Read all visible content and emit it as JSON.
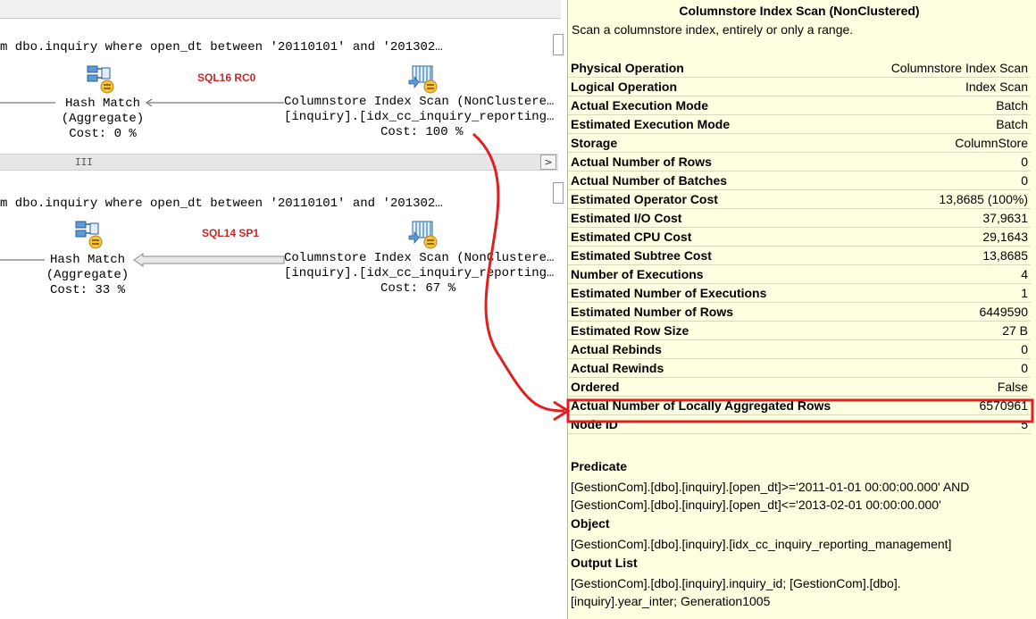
{
  "plan1": {
    "sql": "m dbo.inquiry where open_dt between '20110101' and '201302…",
    "tag": "SQL16 RC0",
    "hash_match": {
      "line1": "Hash Match",
      "line2": "(Aggregate)",
      "cost": "Cost: 0 %"
    },
    "scan": {
      "line1": "Columnstore Index Scan (NonClustere…",
      "line2": "[inquiry].[idx_cc_inquiry_reporting…",
      "cost": "Cost: 100 %"
    },
    "scroll_grip": "III",
    "scroll_btn": ">"
  },
  "plan2": {
    "sql": "m dbo.inquiry where open_dt between '20110101' and '201302…",
    "tag": "SQL14 SP1",
    "hash_match": {
      "line1": "Hash Match",
      "line2": "(Aggregate)",
      "cost": "Cost: 33 %"
    },
    "scan": {
      "line1": "Columnstore Index Scan (NonClustere…",
      "line2": "[inquiry].[idx_cc_inquiry_reporting…",
      "cost": "Cost: 67 %"
    }
  },
  "tooltip": {
    "title": "Columnstore Index Scan (NonClustered)",
    "description": "Scan a columnstore index, entirely or only a range.",
    "properties": [
      {
        "key": "Physical Operation",
        "value": "Columnstore Index Scan"
      },
      {
        "key": "Logical Operation",
        "value": "Index Scan"
      },
      {
        "key": "Actual Execution Mode",
        "value": "Batch"
      },
      {
        "key": "Estimated Execution Mode",
        "value": "Batch"
      },
      {
        "key": "Storage",
        "value": "ColumnStore"
      },
      {
        "key": "Actual Number of Rows",
        "value": "0"
      },
      {
        "key": "Actual Number of Batches",
        "value": "0"
      },
      {
        "key": "Estimated Operator Cost",
        "value": "13,8685 (100%)"
      },
      {
        "key": "Estimated I/O Cost",
        "value": "37,9631"
      },
      {
        "key": "Estimated CPU Cost",
        "value": "29,1643"
      },
      {
        "key": "Estimated Subtree Cost",
        "value": "13,8685"
      },
      {
        "key": "Number of Executions",
        "value": "4"
      },
      {
        "key": "Estimated Number of Executions",
        "value": "1"
      },
      {
        "key": "Estimated Number of Rows",
        "value": "6449590"
      },
      {
        "key": "Estimated Row Size",
        "value": "27 B"
      },
      {
        "key": "Actual Rebinds",
        "value": "0"
      },
      {
        "key": "Actual Rewinds",
        "value": "0"
      },
      {
        "key": "Ordered",
        "value": "False"
      },
      {
        "key": "Actual Number of Locally Aggregated Rows",
        "value": "6570961"
      },
      {
        "key": "Node ID",
        "value": "5"
      }
    ],
    "predicate_label": "Predicate",
    "predicate_line1": "[GestionCom].[dbo].[inquiry].[open_dt]>='2011-01-01 00:00:00.000' AND",
    "predicate_line2": "[GestionCom].[dbo].[inquiry].[open_dt]<='2013-02-01 00:00:00.000'",
    "object_label": "Object",
    "object_value": "[GestionCom].[dbo].[inquiry].[idx_cc_inquiry_reporting_management]",
    "output_label": "Output List",
    "output_line1": "[GestionCom].[dbo].[inquiry].inquiry_id; [GestionCom].[dbo].",
    "output_line2": "[inquiry].year_inter; Generation1005"
  },
  "colors": {
    "annotation": "#e02020",
    "tooltip_bg": "#ffffe1",
    "tag": "#c62828"
  },
  "icons": [
    "hash-match-icon",
    "columnstore-scan-icon",
    "arrow-left-icon"
  ]
}
